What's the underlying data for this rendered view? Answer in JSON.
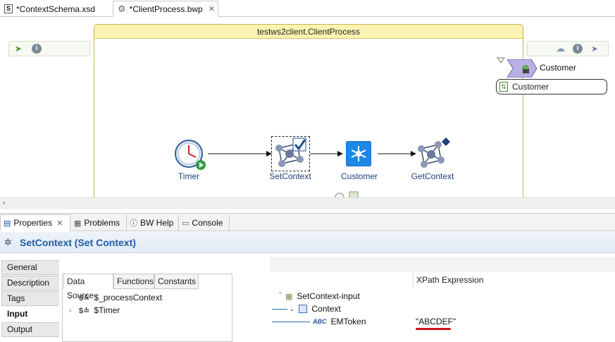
{
  "editor_tabs": [
    {
      "label": "*ContextSchema.xsd",
      "icon": "schema-file-icon"
    },
    {
      "label": "*ClientProcess.bwp",
      "icon": "process-gear-icon"
    }
  ],
  "process": {
    "title": "testws2client.ClientProcess",
    "activities": [
      {
        "label": "Timer",
        "icon": "timer-icon"
      },
      {
        "label": "SetContext",
        "icon": "set-context-icon"
      },
      {
        "label": "Customer",
        "icon": "invoke-service-icon"
      },
      {
        "label": "GetContext",
        "icon": "get-context-icon"
      }
    ],
    "service": {
      "label": "Customer",
      "reference_label": "Customer"
    }
  },
  "bottom_tabs": [
    {
      "label": "Properties",
      "icon": "properties-icon"
    },
    {
      "label": "Problems",
      "icon": "problems-icon"
    },
    {
      "label": "BW Help",
      "icon": "help-icon"
    },
    {
      "label": "Console",
      "icon": "console-icon"
    }
  ],
  "properties": {
    "heading": "SetContext (Set Context)",
    "side_tabs": [
      "General",
      "Description",
      "Tags",
      "Input",
      "Output"
    ],
    "selected_side_tab": "Input",
    "inner_tabs": [
      "Data Source",
      "Functions",
      "Constants"
    ],
    "data_source": [
      {
        "label": "$_processContext"
      },
      {
        "label": "$Timer"
      }
    ],
    "xpath_header": "XPath Expression",
    "mapping": [
      {
        "label": "SetContext-input",
        "value": ""
      },
      {
        "label": "Context",
        "value": ""
      },
      {
        "label": "EMToken",
        "value": "\"ABCDEF\""
      }
    ]
  },
  "colors": {
    "heading": "#1f5ca6",
    "activity_label": "#1f3f7a",
    "underline": "#d0141e",
    "process_title_bg": "#fbf3b2"
  }
}
